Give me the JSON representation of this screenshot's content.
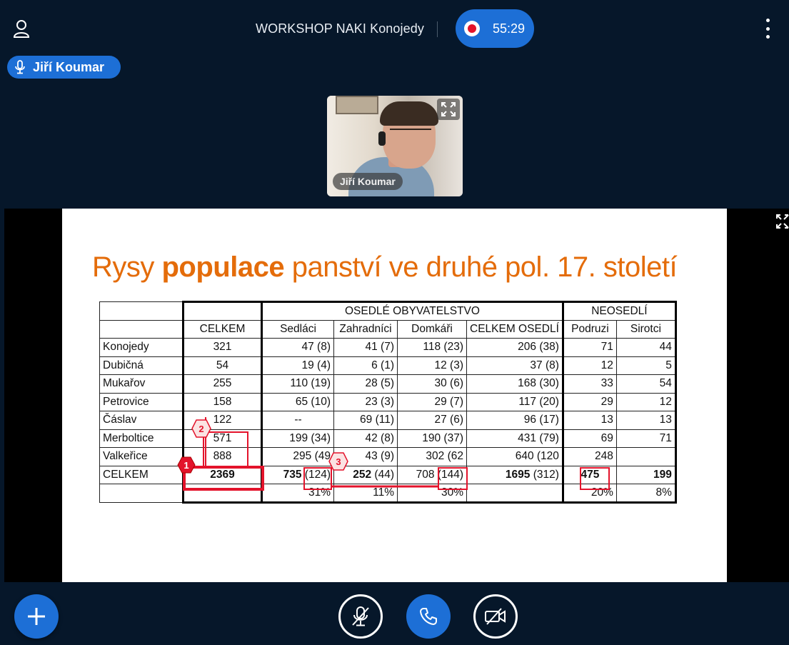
{
  "meeting": {
    "title": "WORKSHOP NAKI Konojedy",
    "record_time": "55:29"
  },
  "speaker": {
    "name": "Jiří Koumar"
  },
  "webcam": {
    "label": "Jiří Koumar"
  },
  "slide": {
    "title_pre": "Rysy ",
    "title_bold": "populace",
    "title_post": " panství ve druhé pol. 17. století",
    "group_settled": "OSEDLÉ OBYVATELSTVO",
    "group_unsettled": "NEOSEDLÍ",
    "headers": [
      "CELKEM",
      "Sedláci",
      "Zahradníci",
      "Domkáři",
      "CELKEM OSEDLÍ",
      "Podruzi",
      "Sirotci"
    ],
    "rows": [
      [
        "Konojedy",
        "321",
        "47 (8)",
        "41 (7)",
        "118 (23)",
        "206 (38)",
        "71",
        "44"
      ],
      [
        "Dubičná",
        "54",
        "19 (4)",
        "6 (1)",
        "12 (3)",
        "37 (8)",
        "12",
        "5"
      ],
      [
        "Mukařov",
        "255",
        "110 (19)",
        "28 (5)",
        "30 (6)",
        "168 (30)",
        "33",
        "54"
      ],
      [
        "Petrovice",
        "158",
        "65 (10)",
        "23 (3)",
        "29 (7)",
        "117 (20)",
        "29",
        "12"
      ],
      [
        "Čáslav",
        "122",
        "--",
        "69 (11)",
        "27 (6)",
        "96 (17)",
        "13",
        "13"
      ],
      [
        "Merboltice",
        "571",
        "199 (34)",
        "42 (8)",
        "190 (37)",
        "431 (79)",
        "69",
        "71"
      ],
      [
        "Valkeřice",
        "888",
        "295 (49",
        "43 (9)",
        "302 (62",
        "640 (120",
        "248",
        ""
      ]
    ],
    "total": {
      "label": "CELKEM",
      "celkem": "2369",
      "sedlaci_bold": "735",
      "sedlaci_rest": " (124)",
      "zahradnici_bold": "252",
      "zahradnici_rest": " (44)",
      "domkari": "708 (144)",
      "osedli_bold": "1695",
      "osedli_rest": " (312)",
      "podruzi": "475",
      "sirotci": "199"
    },
    "percent": {
      "sedlaci": "31%",
      "zahradnici": "11%",
      "domkari": "30%",
      "podruzi": "20%",
      "sirotci": "8%"
    },
    "markers": [
      "1",
      "2",
      "3"
    ]
  },
  "icons": {
    "user": "user-icon",
    "more": "more-vertical-icon",
    "mic": "microphone-icon",
    "expand": "expand-icon",
    "add": "plus-icon",
    "mic_muted": "microphone-muted-icon",
    "phone": "phone-icon",
    "camera_off": "camera-off-icon"
  },
  "colors": {
    "accent": "#1d6fd6",
    "background": "#06172a",
    "title_orange": "#e46c0a",
    "annotation_red": "#e3132b"
  }
}
